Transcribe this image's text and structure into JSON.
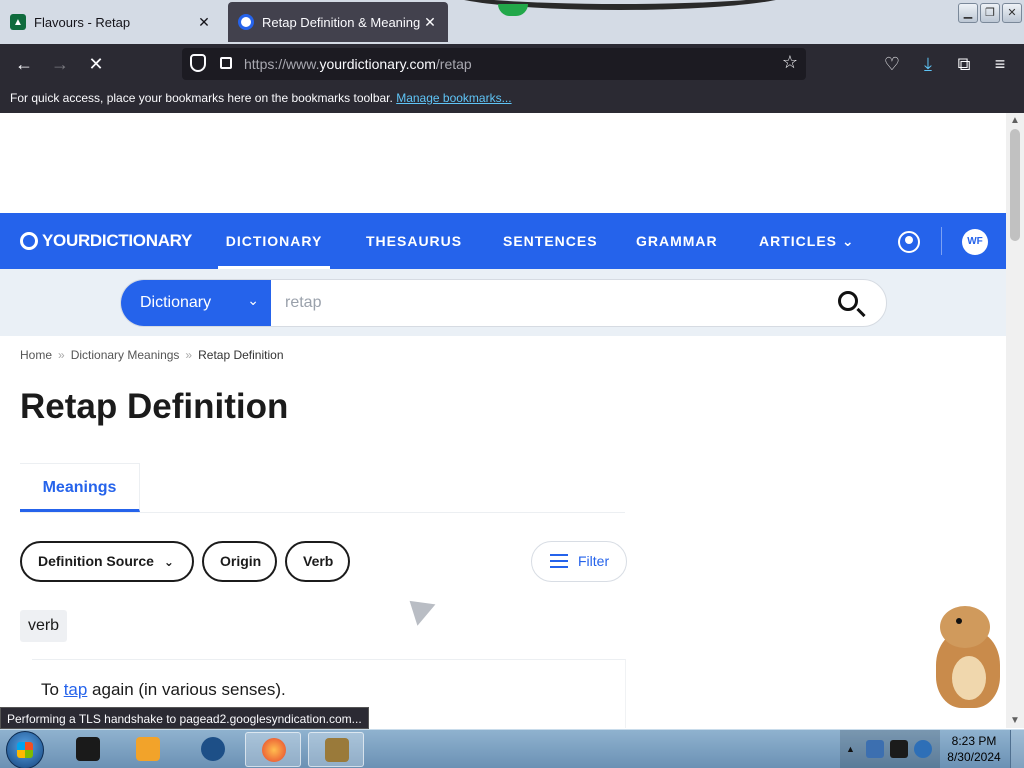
{
  "browser": {
    "tabs": [
      {
        "title": "Flavours - Retap",
        "active": false
      },
      {
        "title": "Retap Definition & Meaning | Y",
        "active": true
      }
    ],
    "url_prefix": "https://www.",
    "url_domain": "yourdictionary.com",
    "url_path": "/retap",
    "bookmarks_message": "For quick access, place your bookmarks here on the bookmarks toolbar.",
    "bookmarks_link": "Manage bookmarks...",
    "status_text": "Performing a TLS handshake to pagead2.googlesyndication.com..."
  },
  "site": {
    "logo": "YOURDICTIONARY",
    "nav": [
      "DICTIONARY",
      "THESAURUS",
      "SENTENCES",
      "GRAMMAR",
      "ARTICLES"
    ],
    "active_nav": "DICTIONARY",
    "brand_color": "#2563eb",
    "wf_logo": "WF"
  },
  "search": {
    "scope": "Dictionary",
    "query": "retap"
  },
  "breadcrumb": [
    "Home",
    "Dictionary Meanings",
    "Retap Definition"
  ],
  "page_title": "Retap Definition",
  "tabs": [
    "Meanings"
  ],
  "filters": {
    "definition_source": "Definition Source",
    "origin": "Origin",
    "verb": "Verb",
    "filter_label": "Filter"
  },
  "entry": {
    "part_of_speech": "verb",
    "definition_before": "To ",
    "definition_link": "tap",
    "definition_after": " again (in various senses)."
  },
  "taskbar": {
    "time": "8:23 PM",
    "date": "8/30/2024"
  }
}
